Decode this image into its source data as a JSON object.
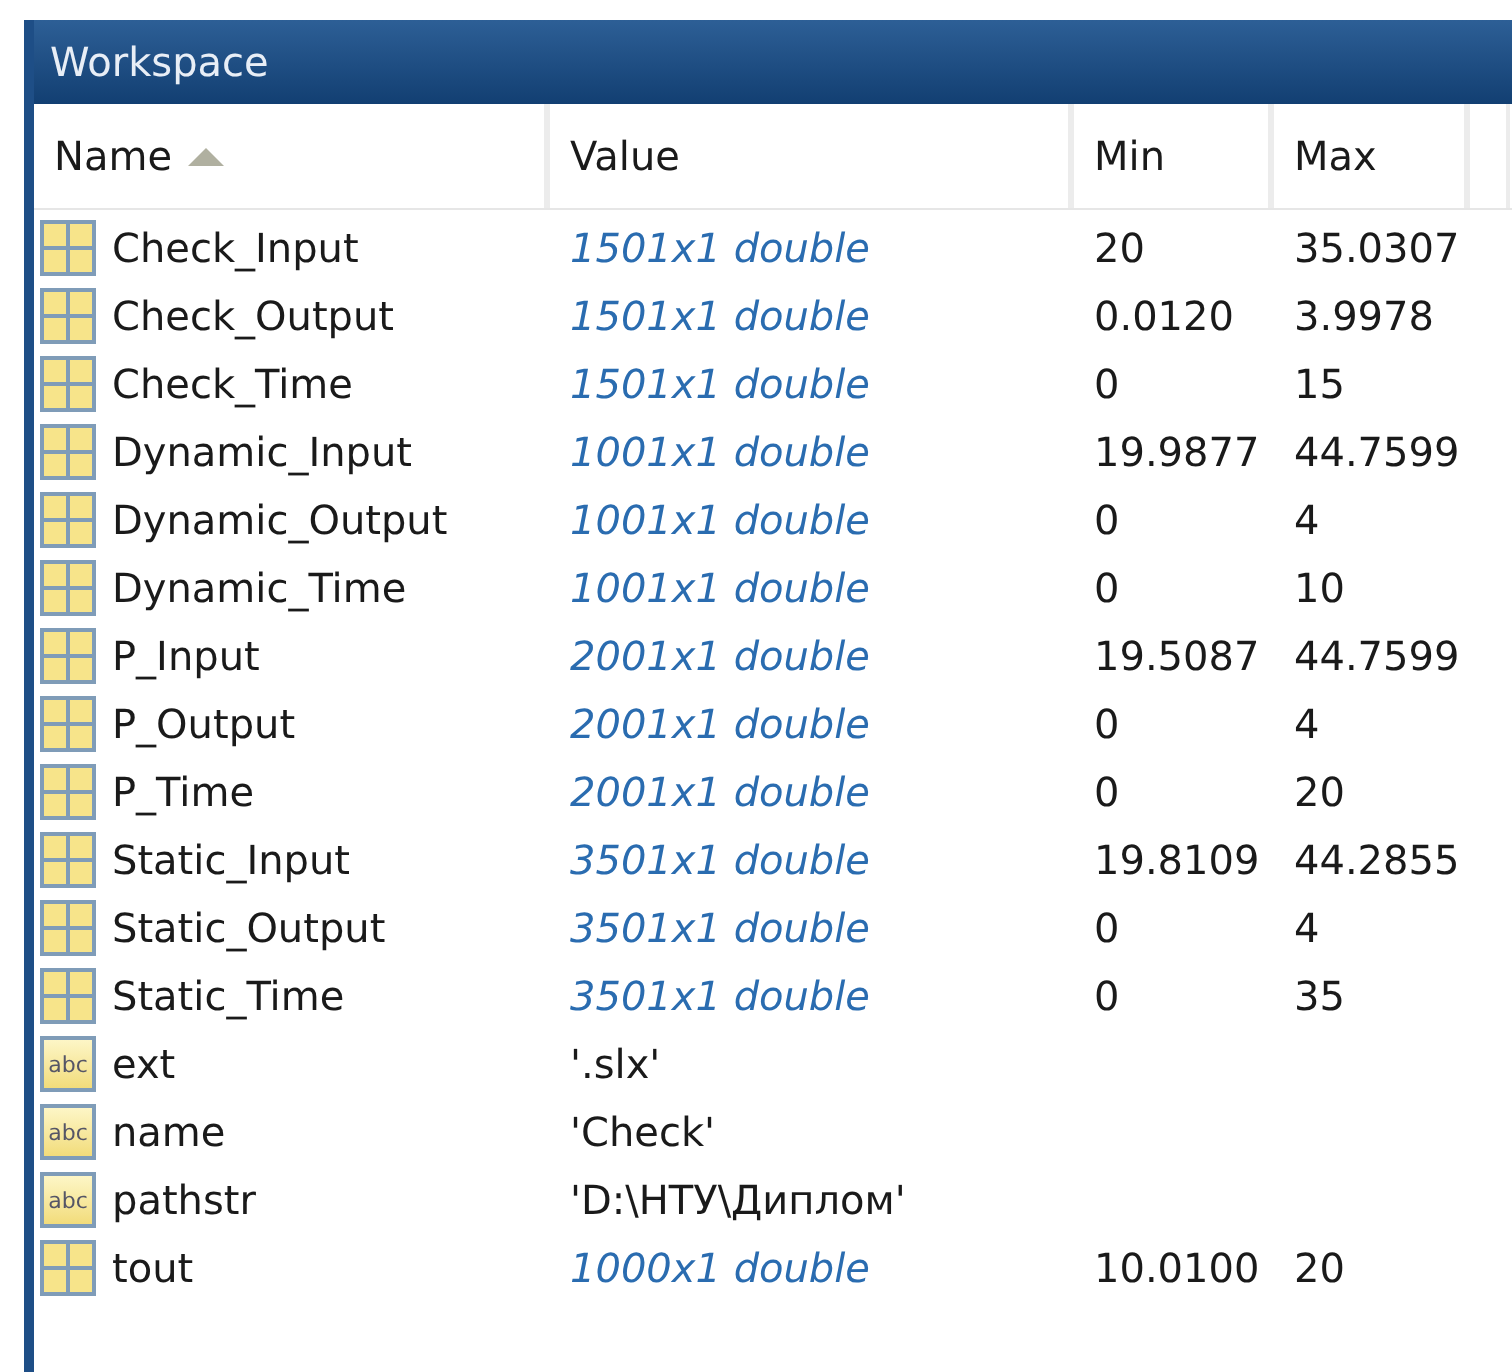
{
  "window": {
    "title": "Workspace"
  },
  "table": {
    "columns": [
      {
        "label": "Name",
        "sorted": true
      },
      {
        "label": "Value",
        "sorted": false
      },
      {
        "label": "Min",
        "sorted": false
      },
      {
        "label": "Max",
        "sorted": false
      }
    ],
    "rows": [
      {
        "kind": "matrix",
        "name": "Check_Input",
        "value": "1501x1 double",
        "min": "20",
        "max": "35.0307"
      },
      {
        "kind": "matrix",
        "name": "Check_Output",
        "value": "1501x1 double",
        "min": "0.0120",
        "max": "3.9978"
      },
      {
        "kind": "matrix",
        "name": "Check_Time",
        "value": "1501x1 double",
        "min": "0",
        "max": "15"
      },
      {
        "kind": "matrix",
        "name": "Dynamic_Input",
        "value": "1001x1 double",
        "min": "19.9877",
        "max": "44.7599"
      },
      {
        "kind": "matrix",
        "name": "Dynamic_Output",
        "value": "1001x1 double",
        "min": "0",
        "max": "4"
      },
      {
        "kind": "matrix",
        "name": "Dynamic_Time",
        "value": "1001x1 double",
        "min": "0",
        "max": "10"
      },
      {
        "kind": "matrix",
        "name": "P_Input",
        "value": "2001x1 double",
        "min": "19.5087",
        "max": "44.7599"
      },
      {
        "kind": "matrix",
        "name": "P_Output",
        "value": "2001x1 double",
        "min": "0",
        "max": "4"
      },
      {
        "kind": "matrix",
        "name": "P_Time",
        "value": "2001x1 double",
        "min": "0",
        "max": "20"
      },
      {
        "kind": "matrix",
        "name": "Static_Input",
        "value": "3501x1 double",
        "min": "19.8109",
        "max": "44.2855"
      },
      {
        "kind": "matrix",
        "name": "Static_Output",
        "value": "3501x1 double",
        "min": "0",
        "max": "4"
      },
      {
        "kind": "matrix",
        "name": "Static_Time",
        "value": "3501x1 double",
        "min": "0",
        "max": "35"
      },
      {
        "kind": "char",
        "icon_label": "abc",
        "name": "ext",
        "value": "'.slx'"
      },
      {
        "kind": "char",
        "icon_label": "abc",
        "name": "name",
        "value": "'Check'"
      },
      {
        "kind": "char",
        "icon_label": "abc",
        "name": "pathstr",
        "value": "'D:\\НТУ\\Диплом'"
      },
      {
        "kind": "matrix",
        "name": "tout",
        "value": "1000x1 double",
        "min": "10.0100",
        "max": "20"
      }
    ]
  }
}
